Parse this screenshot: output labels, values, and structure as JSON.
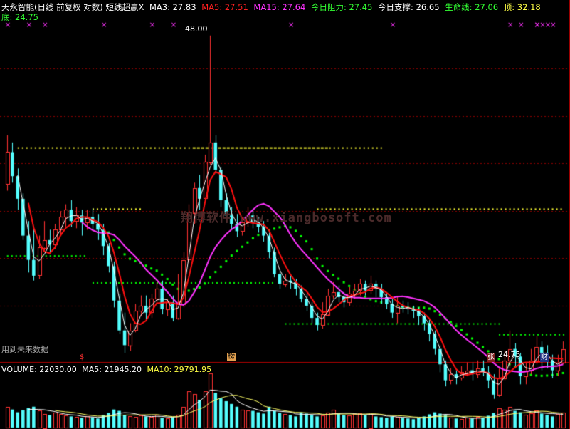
{
  "colors": {
    "background": "#000000",
    "up": "#ff3232",
    "down": "#54ffff",
    "ma_white": "#ffffff",
    "ma_red": "#ff1010",
    "ma_magenta": "#ff33ff",
    "green": "#00ff00",
    "yellow": "#ffff33",
    "cross": "#ff33ff",
    "grid": "#8b0000",
    "vol_ma": "#ffff66"
  },
  "header": {
    "title": "天永智能(日线 前复权 对数) 短线超赢X",
    "ma3_label": "MA3: 27.83",
    "ma5_label": "MA5: 27.51",
    "ma15_label": "MA15: 27.64",
    "resist_label": "今日阻力: 27.45",
    "support_label": "今日支撑: 26.65",
    "life_label": "生命线: 27.06",
    "top_label": "顶: 32.18",
    "bottom_label": "底: 24.75"
  },
  "annotations": {
    "high_label": "48.00",
    "low_label": "24.75",
    "future_note": "用到未来数据",
    "badge_s": "$",
    "badge_rank": "榜",
    "badge_zhang": "张",
    "badge_cai": "财",
    "watermark": "翔博软件 www.xiangbosoft.com"
  },
  "volume_header": {
    "volume_label": "VOLUME: 22030.00",
    "ma5_label": "MA5: 21945.20",
    "ma10_label": "MA10: 29791.95"
  },
  "chart_data": {
    "type": "candlestick",
    "price_range": [
      24.0,
      49.5
    ],
    "candles": [
      [
        34.7,
        37.2,
        38.6,
        34.2
      ],
      [
        37.2,
        35.3,
        38.0,
        34.8
      ],
      [
        35.3,
        33.6,
        35.9,
        32.8
      ],
      [
        33.6,
        31.0,
        34.0,
        30.7
      ],
      [
        31.0,
        29.4,
        32.0,
        28.6
      ],
      [
        29.4,
        28.4,
        31.5,
        28.1
      ],
      [
        28.4,
        30.2,
        31.0,
        28.2
      ],
      [
        30.2,
        30.7,
        32.0,
        30.0
      ],
      [
        30.7,
        30.4,
        31.4,
        29.8
      ],
      [
        30.4,
        31.4,
        31.8,
        30.1
      ],
      [
        31.4,
        32.3,
        32.7,
        31.0
      ],
      [
        32.3,
        32.8,
        33.2,
        31.6
      ],
      [
        32.8,
        32.0,
        33.5,
        31.6
      ],
      [
        32.0,
        32.4,
        33.0,
        31.5
      ],
      [
        32.4,
        31.9,
        32.8,
        31.0
      ],
      [
        31.9,
        32.3,
        32.8,
        31.4
      ],
      [
        32.3,
        31.8,
        32.9,
        31.3
      ],
      [
        31.8,
        31.4,
        32.5,
        30.7
      ],
      [
        31.4,
        30.3,
        31.8,
        29.7
      ],
      [
        30.3,
        29.0,
        30.5,
        28.6
      ],
      [
        29.0,
        26.9,
        29.3,
        26.5
      ],
      [
        26.9,
        25.2,
        27.3,
        25.0
      ],
      [
        25.2,
        24.4,
        26.2,
        24.0
      ],
      [
        24.4,
        25.2,
        25.6,
        24.1
      ],
      [
        25.2,
        26.3,
        26.7,
        25.1
      ],
      [
        26.3,
        26.6,
        27.2,
        26.0
      ],
      [
        26.6,
        26.2,
        27.2,
        25.8
      ],
      [
        26.2,
        27.0,
        27.3,
        25.9
      ],
      [
        27.0,
        27.6,
        28.0,
        26.8
      ],
      [
        27.6,
        26.4,
        28.1,
        26.1
      ],
      [
        26.4,
        26.8,
        27.0,
        26.0
      ],
      [
        26.8,
        25.9,
        27.2,
        25.7
      ],
      [
        25.9,
        26.7,
        28.5,
        25.8
      ],
      [
        26.7,
        29.4,
        29.9,
        26.5
      ],
      [
        29.4,
        32.6,
        33.2,
        29.2
      ],
      [
        32.6,
        34.4,
        34.8,
        31.8
      ],
      [
        34.4,
        33.6,
        35.4,
        32.8
      ],
      [
        33.6,
        36.4,
        37.0,
        33.4
      ],
      [
        36.4,
        38.0,
        48.0,
        36.2
      ],
      [
        38.0,
        35.8,
        38.6,
        35.5
      ],
      [
        35.8,
        33.5,
        36.0,
        33.0
      ],
      [
        33.5,
        32.4,
        34.0,
        31.9
      ],
      [
        32.4,
        31.8,
        33.0,
        31.4
      ],
      [
        31.8,
        31.3,
        32.5,
        30.9
      ],
      [
        31.3,
        31.9,
        32.2,
        31.0
      ],
      [
        31.9,
        32.4,
        33.0,
        31.6
      ],
      [
        32.4,
        31.9,
        32.8,
        31.5
      ],
      [
        31.9,
        31.6,
        32.3,
        31.2
      ],
      [
        31.6,
        31.0,
        32.0,
        30.6
      ],
      [
        31.0,
        29.9,
        31.2,
        29.5
      ],
      [
        29.9,
        28.5,
        30.2,
        28.3
      ],
      [
        28.5,
        27.9,
        28.8,
        27.6
      ],
      [
        27.9,
        28.1,
        28.5,
        27.7
      ],
      [
        28.1,
        28.0,
        28.4,
        27.6
      ],
      [
        28.0,
        27.6,
        28.2,
        27.2
      ],
      [
        27.6,
        27.0,
        27.8,
        26.8
      ],
      [
        27.0,
        26.6,
        27.3,
        26.3
      ],
      [
        26.6,
        25.9,
        26.8,
        25.6
      ],
      [
        25.9,
        25.5,
        26.2,
        25.2
      ],
      [
        25.5,
        26.1,
        26.8,
        25.3
      ],
      [
        26.1,
        27.2,
        27.6,
        26.0
      ],
      [
        27.2,
        27.4,
        28.0,
        27.0
      ],
      [
        27.4,
        27.1,
        27.8,
        26.8
      ],
      [
        27.1,
        26.8,
        27.4,
        26.5
      ],
      [
        26.8,
        27.3,
        27.7,
        26.6
      ],
      [
        27.3,
        27.5,
        27.9,
        27.0
      ],
      [
        27.5,
        27.9,
        28.2,
        27.2
      ],
      [
        27.9,
        27.5,
        28.1,
        27.2
      ],
      [
        27.5,
        27.9,
        28.4,
        27.3
      ],
      [
        27.9,
        27.6,
        28.1,
        27.1
      ],
      [
        27.6,
        27.1,
        27.9,
        26.7
      ],
      [
        27.1,
        26.7,
        27.4,
        26.4
      ],
      [
        26.7,
        26.2,
        27.0,
        25.9
      ],
      [
        26.2,
        26.6,
        27.1,
        25.6
      ],
      [
        26.6,
        26.5,
        26.9,
        26.2
      ],
      [
        26.5,
        26.4,
        26.8,
        26.1
      ],
      [
        26.4,
        26.3,
        26.6,
        25.9
      ],
      [
        26.3,
        26.0,
        26.5,
        25.5
      ],
      [
        26.0,
        25.6,
        26.2,
        25.2
      ],
      [
        25.6,
        25.0,
        25.8,
        24.6
      ],
      [
        25.0,
        24.2,
        25.2,
        23.9
      ],
      [
        24.2,
        23.4,
        24.4,
        23.0
      ],
      [
        23.4,
        22.6,
        23.6,
        22.3
      ],
      [
        22.6,
        22.9,
        23.2,
        22.4
      ],
      [
        22.9,
        22.7,
        23.1,
        22.4
      ],
      [
        22.7,
        23.0,
        23.3,
        22.6
      ],
      [
        23.0,
        23.1,
        23.5,
        22.8
      ],
      [
        23.1,
        22.9,
        23.5,
        22.6
      ],
      [
        22.9,
        23.2,
        23.6,
        22.7
      ],
      [
        23.2,
        23.0,
        23.6,
        22.8
      ],
      [
        23.0,
        22.6,
        23.3,
        22.2
      ],
      [
        22.6,
        21.9,
        22.9,
        21.7
      ],
      [
        21.9,
        22.7,
        23.2,
        21.8
      ],
      [
        22.7,
        23.6,
        24.1,
        22.6
      ],
      [
        23.6,
        24.2,
        25.2,
        23.2
      ],
      [
        24.2,
        23.8,
        24.5,
        23.2
      ],
      [
        23.8,
        22.8,
        24.0,
        22.4
      ],
      [
        22.8,
        23.1,
        23.5,
        22.4
      ],
      [
        23.1,
        23.6,
        24.2,
        22.9
      ],
      [
        23.6,
        24.3,
        24.9,
        23.4
      ],
      [
        24.3,
        24.0,
        24.6,
        23.1
      ],
      [
        24.0,
        23.6,
        24.4,
        23.2
      ],
      [
        23.6,
        23.1,
        23.9,
        22.7
      ],
      [
        23.1,
        23.5,
        23.9,
        22.8
      ],
      [
        23.5,
        24.2,
        24.6,
        23.4
      ]
    ],
    "volume_range": [
      0,
      80000
    ],
    "volumes": [
      30000,
      26000,
      22000,
      25000,
      28000,
      30000,
      25000,
      20000,
      18000,
      22000,
      19000,
      17000,
      16000,
      15000,
      14000,
      16000,
      15000,
      13000,
      18000,
      21000,
      26000,
      24000,
      18000,
      16000,
      15000,
      17000,
      16000,
      15000,
      18000,
      14000,
      13000,
      15000,
      18000,
      30000,
      52000,
      48000,
      40000,
      52000,
      78000,
      50000,
      42000,
      38000,
      34000,
      30000,
      26000,
      25000,
      24000,
      22000,
      20000,
      30000,
      24000,
      21000,
      19000,
      18000,
      16000,
      22000,
      20000,
      18000,
      16000,
      17000,
      22000,
      26000,
      20000,
      18000,
      17000,
      19000,
      21000,
      18000,
      20000,
      16000,
      15000,
      14000,
      16000,
      15000,
      14000,
      13000,
      12000,
      14000,
      16000,
      19000,
      22000,
      20000,
      18000,
      14000,
      13000,
      12000,
      14000,
      13000,
      15000,
      14000,
      17000,
      21000,
      28000,
      26000,
      30000,
      24000,
      22000,
      18000,
      21000,
      25000,
      20000,
      18000,
      16000,
      19000,
      22030
    ],
    "support_levels": [
      37.6,
      32.9,
      29.7,
      28.0,
      25.6,
      25.0
    ]
  }
}
